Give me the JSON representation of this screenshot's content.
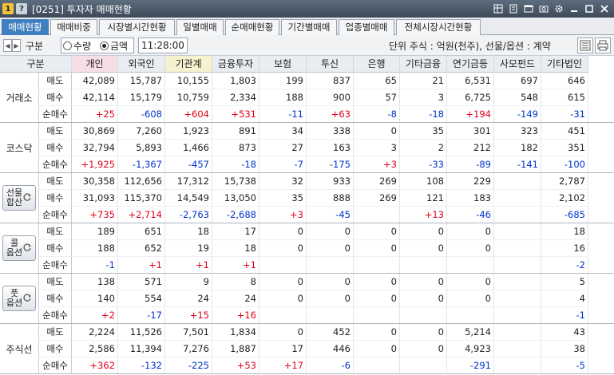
{
  "window": {
    "badge1": "1",
    "badge2": "?",
    "title": "[0251] 투자자 매매현황",
    "icons": [
      "menu-grid-icon",
      "link-icon",
      "window-icon",
      "camera-icon",
      "gear-icon",
      "minimize-icon",
      "maximize-icon",
      "close-icon"
    ]
  },
  "tabs": [
    "매매현황",
    "매매비중",
    "시장별시간현황",
    "일별매매",
    "순매매현황",
    "기간별매매",
    "업종별매매",
    "전체시장시간현황"
  ],
  "active_tab": "매매현황",
  "controls": {
    "group_label": "구분",
    "radio_qty": "수량",
    "radio_amt": "금액",
    "selected_radio": "금액",
    "time": "11:28:00",
    "unit_text": "단위 주식 : 억원(천주), 선물/옵션 : 계약"
  },
  "columns": [
    "구분",
    "개인",
    "외국인",
    "기관계",
    "금융투자",
    "보험",
    "투신",
    "은행",
    "기타금융",
    "연기금등",
    "사모펀드",
    "기타법인"
  ],
  "groups": [
    {
      "name": "거래소",
      "button": false,
      "rows": [
        {
          "label": "매도",
          "values": [
            "42,089",
            "15,787",
            "10,155",
            "1,803",
            "199",
            "837",
            "65",
            "21",
            "6,531",
            "697",
            "646"
          ]
        },
        {
          "label": "매수",
          "values": [
            "42,114",
            "15,179",
            "10,759",
            "2,334",
            "188",
            "900",
            "57",
            "3",
            "6,725",
            "548",
            "615"
          ]
        },
        {
          "label": "순매수",
          "values": [
            "+25",
            "-608",
            "+604",
            "+531",
            "-11",
            "+63",
            "-8",
            "-18",
            "+194",
            "-149",
            "-31"
          ]
        }
      ]
    },
    {
      "name": "코스닥",
      "button": false,
      "rows": [
        {
          "label": "매도",
          "values": [
            "30,869",
            "7,260",
            "1,923",
            "891",
            "34",
            "338",
            "0",
            "35",
            "301",
            "323",
            "451"
          ]
        },
        {
          "label": "매수",
          "values": [
            "32,794",
            "5,893",
            "1,466",
            "873",
            "27",
            "163",
            "3",
            "2",
            "212",
            "182",
            "351"
          ]
        },
        {
          "label": "순매수",
          "values": [
            "+1,925",
            "-1,367",
            "-457",
            "-18",
            "-7",
            "-175",
            "+3",
            "-33",
            "-89",
            "-141",
            "-100"
          ]
        }
      ]
    },
    {
      "name": "선물\n합산",
      "button": true,
      "rows": [
        {
          "label": "매도",
          "values": [
            "30,358",
            "112,656",
            "17,312",
            "15,738",
            "32",
            "933",
            "269",
            "108",
            "229",
            "",
            "2,787"
          ]
        },
        {
          "label": "매수",
          "values": [
            "31,093",
            "115,370",
            "14,549",
            "13,050",
            "35",
            "888",
            "269",
            "121",
            "183",
            "",
            "2,102"
          ]
        },
        {
          "label": "순매수",
          "values": [
            "+735",
            "+2,714",
            "-2,763",
            "-2,688",
            "+3",
            "-45",
            "",
            "+13",
            "-46",
            "",
            "-685"
          ]
        }
      ]
    },
    {
      "name": "콜\n옵션",
      "button": true,
      "rows": [
        {
          "label": "매도",
          "values": [
            "189",
            "651",
            "18",
            "17",
            "0",
            "0",
            "0",
            "0",
            "0",
            "",
            "18"
          ]
        },
        {
          "label": "매수",
          "values": [
            "188",
            "652",
            "19",
            "18",
            "0",
            "0",
            "0",
            "0",
            "0",
            "",
            "16"
          ]
        },
        {
          "label": "순매수",
          "values": [
            "-1",
            "+1",
            "+1",
            "+1",
            "",
            "",
            "",
            "",
            "",
            "",
            "-2"
          ]
        }
      ]
    },
    {
      "name": "풋\n옵션",
      "button": true,
      "rows": [
        {
          "label": "매도",
          "values": [
            "138",
            "571",
            "9",
            "8",
            "0",
            "0",
            "0",
            "0",
            "0",
            "",
            "5"
          ]
        },
        {
          "label": "매수",
          "values": [
            "140",
            "554",
            "24",
            "24",
            "0",
            "0",
            "0",
            "0",
            "0",
            "",
            "4"
          ]
        },
        {
          "label": "순매수",
          "values": [
            "+2",
            "-17",
            "+15",
            "+16",
            "",
            "",
            "",
            "",
            "",
            "",
            "-1"
          ]
        }
      ]
    },
    {
      "name": "주식선",
      "button": false,
      "rows": [
        {
          "label": "매도",
          "values": [
            "2,224",
            "11,526",
            "7,501",
            "1,834",
            "0",
            "452",
            "0",
            "0",
            "5,214",
            "",
            "43"
          ]
        },
        {
          "label": "매수",
          "values": [
            "2,586",
            "11,394",
            "7,276",
            "1,887",
            "17",
            "446",
            "0",
            "0",
            "4,923",
            "",
            "38"
          ]
        },
        {
          "label": "순매수",
          "values": [
            "+362",
            "-132",
            "-225",
            "+53",
            "+17",
            "-6",
            "",
            "",
            "-291",
            "",
            "-5"
          ]
        }
      ]
    }
  ],
  "colors": {
    "up": "#e0001a",
    "down": "#0033cc",
    "tab_active": "#3f7fbf",
    "header_pink": "#f7dee6",
    "header_yellow": "#f6f1cf"
  }
}
